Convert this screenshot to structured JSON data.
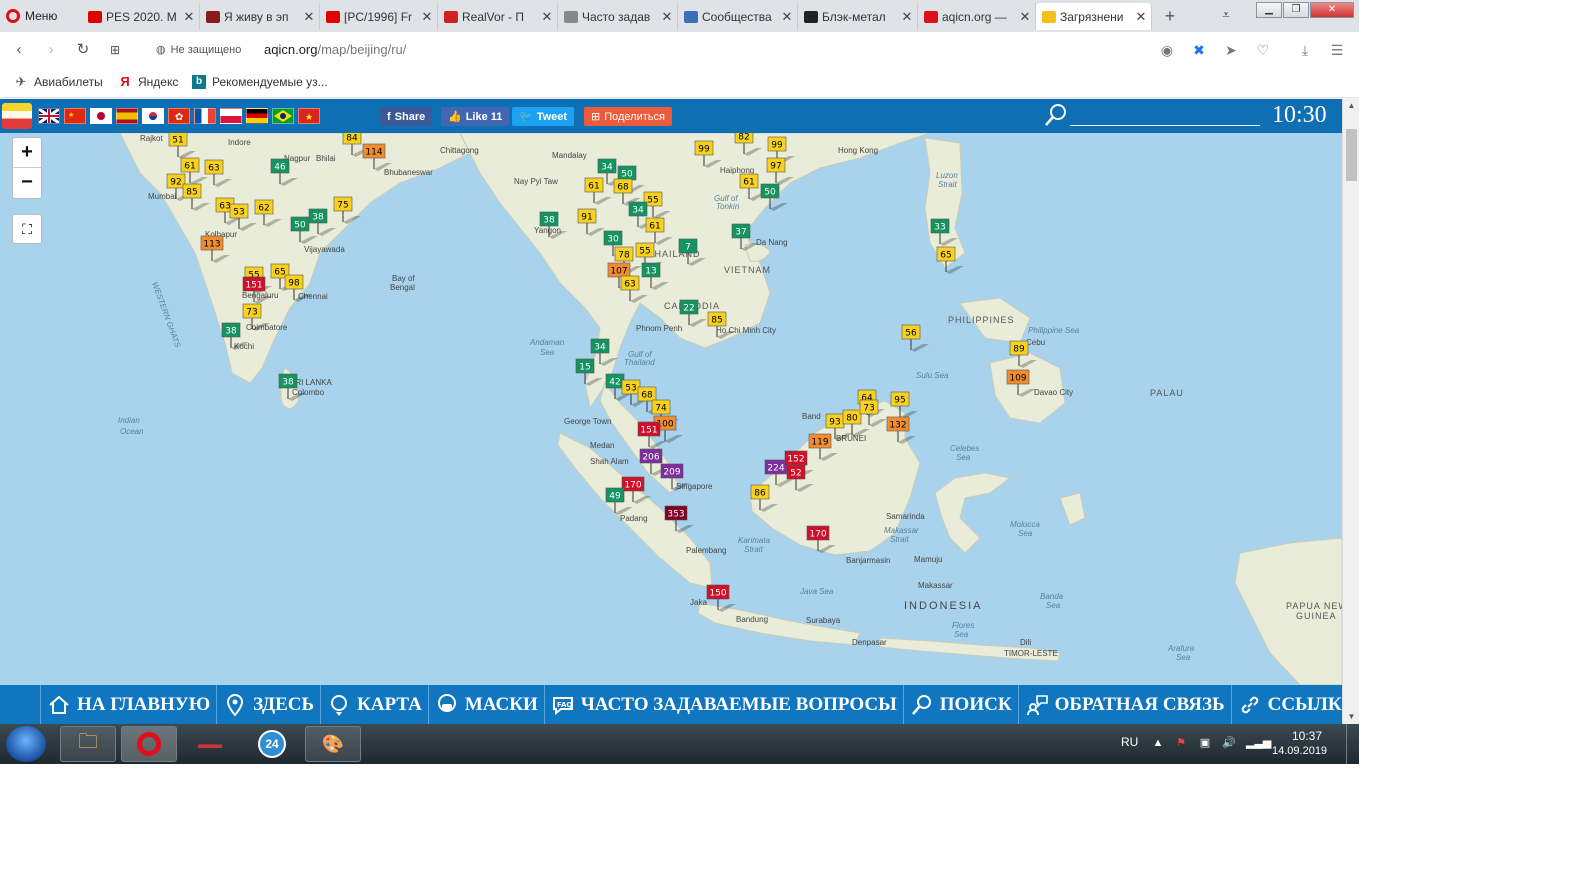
{
  "browser": {
    "menu_label": "Меню",
    "tabs": [
      {
        "title": "PES 2020. M",
        "color": "#e00000"
      },
      {
        "title": "Я живу в эп",
        "color": "#8b1a1a"
      },
      {
        "title": "[PC/1996] Fr",
        "color": "#e00000"
      },
      {
        "title": "RealVor - П",
        "color": "#cc2222"
      },
      {
        "title": "Часто задав",
        "color": "#888888"
      },
      {
        "title": "Сообщества",
        "color": "#3b6fb6"
      },
      {
        "title": "Блэк-метал",
        "color": "#222222"
      },
      {
        "title": "aqicn.org —",
        "color": "#e0101b"
      },
      {
        "title": "Загрязнени",
        "color": "#f2c21b"
      }
    ],
    "not_secure": "Не защищено",
    "url_host": "aqicn.org",
    "url_path": "/map/beijing/ru/",
    "bookmarks": [
      "Авиабилеты",
      "Яндекс",
      "Рекомендуемые уз..."
    ]
  },
  "site": {
    "share_label": "Share",
    "like_label": "Like 11",
    "tweet_label": "Tweet",
    "podelitsya_label": "Поделиться",
    "clock": "10:30",
    "flags": [
      "gb",
      "cn",
      "jp",
      "es",
      "kr",
      "hk",
      "fr",
      "pl",
      "de",
      "br",
      "vn"
    ]
  },
  "map": {
    "zoom_in": "+",
    "zoom_out": "−",
    "markers": [
      {
        "v": "51",
        "c": "#f7d11d",
        "t": "#000"
      },
      {
        "v": "84",
        "c": "#f7d11d",
        "t": "#000"
      },
      {
        "v": "114",
        "c": "#f08d30",
        "t": "#000"
      },
      {
        "v": "61",
        "c": "#f7d11d",
        "t": "#000"
      },
      {
        "v": "63",
        "c": "#f7d11d",
        "t": "#000"
      },
      {
        "v": "46",
        "c": "#149460",
        "t": "#fff"
      },
      {
        "v": "92",
        "c": "#f7d11d",
        "t": "#000"
      },
      {
        "v": "85",
        "c": "#f7d11d",
        "t": "#000"
      },
      {
        "v": "63",
        "c": "#f7d11d",
        "t": "#000"
      },
      {
        "v": "53",
        "c": "#f7d11d",
        "t": "#000"
      },
      {
        "v": "62",
        "c": "#f7d11d",
        "t": "#000"
      },
      {
        "v": "38",
        "c": "#149460",
        "t": "#fff"
      },
      {
        "v": "50",
        "c": "#149460",
        "t": "#fff"
      },
      {
        "v": "75",
        "c": "#f7d11d",
        "t": "#000"
      },
      {
        "v": "113",
        "c": "#f08d30",
        "t": "#000"
      },
      {
        "v": "55",
        "c": "#f7d11d",
        "t": "#000"
      },
      {
        "v": "65",
        "c": "#f7d11d",
        "t": "#000"
      },
      {
        "v": "151",
        "c": "#d0102a",
        "t": "#fff"
      },
      {
        "v": "98",
        "c": "#f7d11d",
        "t": "#000"
      },
      {
        "v": "73",
        "c": "#f7d11d",
        "t": "#000"
      },
      {
        "v": "38",
        "c": "#149460",
        "t": "#fff"
      },
      {
        "v": "38",
        "c": "#149460",
        "t": "#fff"
      },
      {
        "v": "38",
        "c": "#149460",
        "t": "#fff"
      },
      {
        "v": "34",
        "c": "#149460",
        "t": "#fff"
      },
      {
        "v": "50",
        "c": "#149460",
        "t": "#fff"
      },
      {
        "v": "61",
        "c": "#f7d11d",
        "t": "#000"
      },
      {
        "v": "68",
        "c": "#f7d11d",
        "t": "#000"
      },
      {
        "v": "55",
        "c": "#f7d11d",
        "t": "#000"
      },
      {
        "v": "34",
        "c": "#149460",
        "t": "#fff"
      },
      {
        "v": "91",
        "c": "#f7d11d",
        "t": "#000"
      },
      {
        "v": "61",
        "c": "#f7d11d",
        "t": "#000"
      },
      {
        "v": "30",
        "c": "#149460",
        "t": "#fff"
      },
      {
        "v": "55",
        "c": "#f7d11d",
        "t": "#000"
      },
      {
        "v": "78",
        "c": "#f7d11d",
        "t": "#000"
      },
      {
        "v": "107",
        "c": "#f08d30",
        "t": "#000"
      },
      {
        "v": "13",
        "c": "#149460",
        "t": "#fff"
      },
      {
        "v": "63",
        "c": "#f7d11d",
        "t": "#000"
      },
      {
        "v": "7",
        "c": "#149460",
        "t": "#fff"
      },
      {
        "v": "22",
        "c": "#149460",
        "t": "#fff"
      },
      {
        "v": "85",
        "c": "#f7d11d",
        "t": "#000"
      },
      {
        "v": "37",
        "c": "#149460",
        "t": "#fff"
      },
      {
        "v": "99",
        "c": "#f7d11d",
        "t": "#000"
      },
      {
        "v": "82",
        "c": "#f7d11d",
        "t": "#000"
      },
      {
        "v": "99",
        "c": "#f7d11d",
        "t": "#000"
      },
      {
        "v": "97",
        "c": "#f7d11d",
        "t": "#000"
      },
      {
        "v": "61",
        "c": "#f7d11d",
        "t": "#000"
      },
      {
        "v": "50",
        "c": "#149460",
        "t": "#fff"
      },
      {
        "v": "33",
        "c": "#149460",
        "t": "#fff"
      },
      {
        "v": "65",
        "c": "#f7d11d",
        "t": "#000"
      },
      {
        "v": "56",
        "c": "#f7d11d",
        "t": "#000"
      },
      {
        "v": "89",
        "c": "#f7d11d",
        "t": "#000"
      },
      {
        "v": "109",
        "c": "#f08d30",
        "t": "#000"
      },
      {
        "v": "34",
        "c": "#149460",
        "t": "#fff"
      },
      {
        "v": "15",
        "c": "#149460",
        "t": "#fff"
      },
      {
        "v": "42",
        "c": "#149460",
        "t": "#fff"
      },
      {
        "v": "53",
        "c": "#f7d11d",
        "t": "#000"
      },
      {
        "v": "68",
        "c": "#f7d11d",
        "t": "#000"
      },
      {
        "v": "74",
        "c": "#f7d11d",
        "t": "#000"
      },
      {
        "v": "100",
        "c": "#f08d30",
        "t": "#000"
      },
      {
        "v": "151",
        "c": "#d0102a",
        "t": "#fff"
      },
      {
        "v": "206",
        "c": "#7d2f9e",
        "t": "#fff"
      },
      {
        "v": "209",
        "c": "#7d2f9e",
        "t": "#fff"
      },
      {
        "v": "170",
        "c": "#d0102a",
        "t": "#fff"
      },
      {
        "v": "49",
        "c": "#149460",
        "t": "#fff"
      },
      {
        "v": "353",
        "c": "#7e0023",
        "t": "#fff"
      },
      {
        "v": "150",
        "c": "#d0102a",
        "t": "#fff"
      },
      {
        "v": "64",
        "c": "#f7d11d",
        "t": "#000"
      },
      {
        "v": "95",
        "c": "#f7d11d",
        "t": "#000"
      },
      {
        "v": "93",
        "c": "#f7d11d",
        "t": "#000"
      },
      {
        "v": "80",
        "c": "#f7d11d",
        "t": "#000"
      },
      {
        "v": "73",
        "c": "#f7d11d",
        "t": "#000"
      },
      {
        "v": "132",
        "c": "#f08d30",
        "t": "#000"
      },
      {
        "v": "119",
        "c": "#f08d30",
        "t": "#000"
      },
      {
        "v": "224",
        "c": "#7d2f9e",
        "t": "#fff"
      },
      {
        "v": "152",
        "c": "#d0102a",
        "t": "#fff"
      },
      {
        "v": "52",
        "c": "#d0102a",
        "t": "#fff"
      },
      {
        "v": "86",
        "c": "#f7d11d",
        "t": "#000"
      },
      {
        "v": "170",
        "c": "#d0102a",
        "t": "#fff"
      }
    ]
  },
  "nav": [
    {
      "label": "НА ГЛАВНУЮ",
      "icon": "home-icon"
    },
    {
      "label": "ЗДЕСЬ",
      "icon": "location-pin-icon"
    },
    {
      "label": "КАРТА",
      "icon": "map-icon"
    },
    {
      "label": "МАСКИ",
      "icon": "mask-icon"
    },
    {
      "label": "ЧАСТО ЗАДАВАЕМЫЕ ВОПРОСЫ",
      "icon": "faq-icon"
    },
    {
      "label": "ПОИСК",
      "icon": "search-icon"
    },
    {
      "label": "ОБРАТНАЯ СВЯЗЬ",
      "icon": "feedback-icon"
    },
    {
      "label": "ССЫЛКИ",
      "icon": "link-icon"
    }
  ],
  "taskbar": {
    "lang": "RU",
    "time": "10:37",
    "date": "14.09.2019",
    "app_badge": "24"
  }
}
